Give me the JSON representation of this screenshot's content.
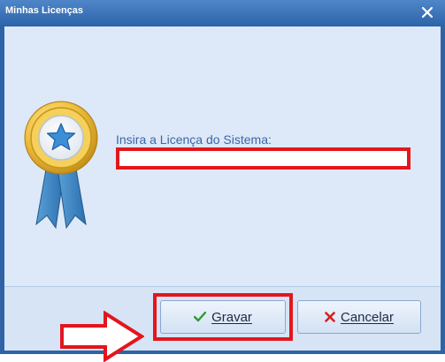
{
  "window": {
    "title": "Minhas Licenças"
  },
  "form": {
    "license_label": "Insira a Licença do Sistema:",
    "license_value": ""
  },
  "buttons": {
    "save_label": "Gravar",
    "cancel_label": "Cancelar"
  },
  "icons": {
    "close": "close-icon",
    "medal": "award-medal-icon",
    "save": "checkmark-icon",
    "cancel": "red-x-icon",
    "annotation": "red-arrow-icon"
  },
  "colors": {
    "titlebar": "#2f63a6",
    "client": "#dde9f8",
    "highlight": "#e3161d",
    "label": "#3b66a8",
    "check": "#2f9a2f",
    "cancel_x": "#d42020"
  }
}
